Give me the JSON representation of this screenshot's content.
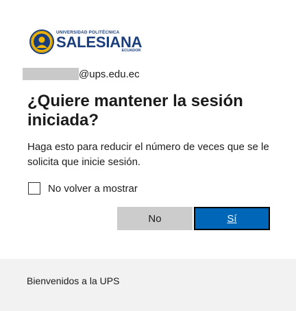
{
  "logo": {
    "line1": "UNIVERSIDAD POLITÉCNICA",
    "line2": "SALESIANA",
    "line3": "ECUADOR",
    "icon": "ups-emblem-icon"
  },
  "identity": {
    "domain": "@ups.edu.ec"
  },
  "prompt": {
    "title": "¿Quiere mantener la sesión iniciada?",
    "description": "Haga esto para reducir el número de veces que se le solicita que inicie sesión."
  },
  "checkbox": {
    "label": "No volver a mostrar",
    "checked": false
  },
  "buttons": {
    "no_label": "No",
    "yes_label": "Sí"
  },
  "footer": {
    "text": "Bienvenidos a la UPS"
  },
  "colors": {
    "primary_button": "#0067b8",
    "secondary_button": "#cccccc",
    "brand_navy": "#1a3d7c",
    "brand_gold": "#f2b705",
    "footer_bg": "#f2f2f2"
  }
}
